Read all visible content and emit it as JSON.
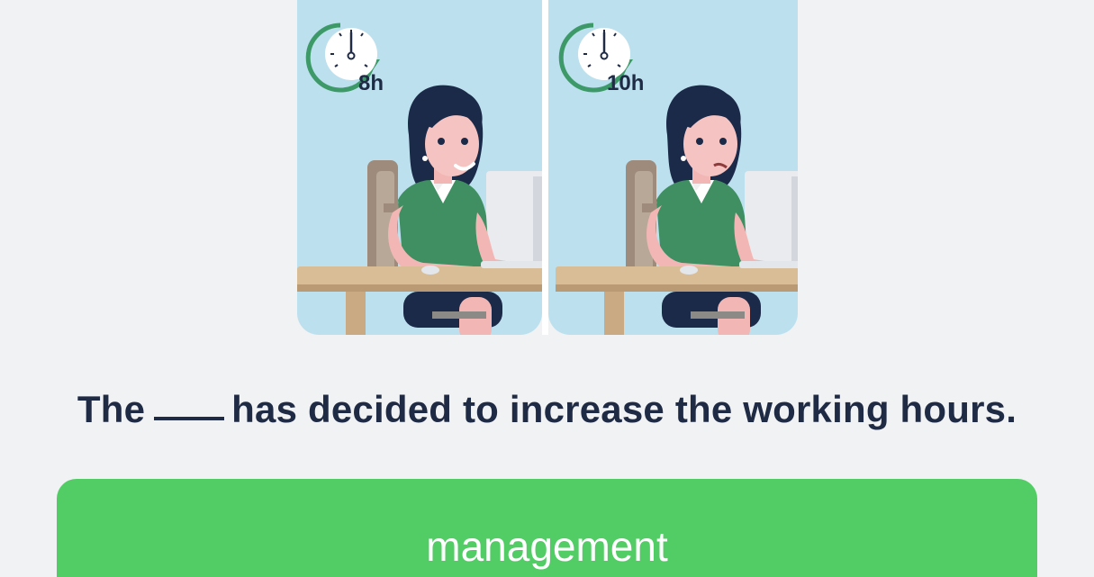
{
  "question": {
    "before": "The",
    "after": "has decided to increase the working hours."
  },
  "illustration": {
    "left_panel": {
      "clock_label": "8h",
      "mood": "happy"
    },
    "right_panel": {
      "clock_label": "10h",
      "mood": "tired"
    }
  },
  "answer_option": {
    "label": "management"
  },
  "colors": {
    "background": "#f1f2f4",
    "text": "#1f2a44",
    "answer_button": "#52cd65",
    "panel_bg": "#bde0ee",
    "clock_ring": "#3d9a68"
  }
}
